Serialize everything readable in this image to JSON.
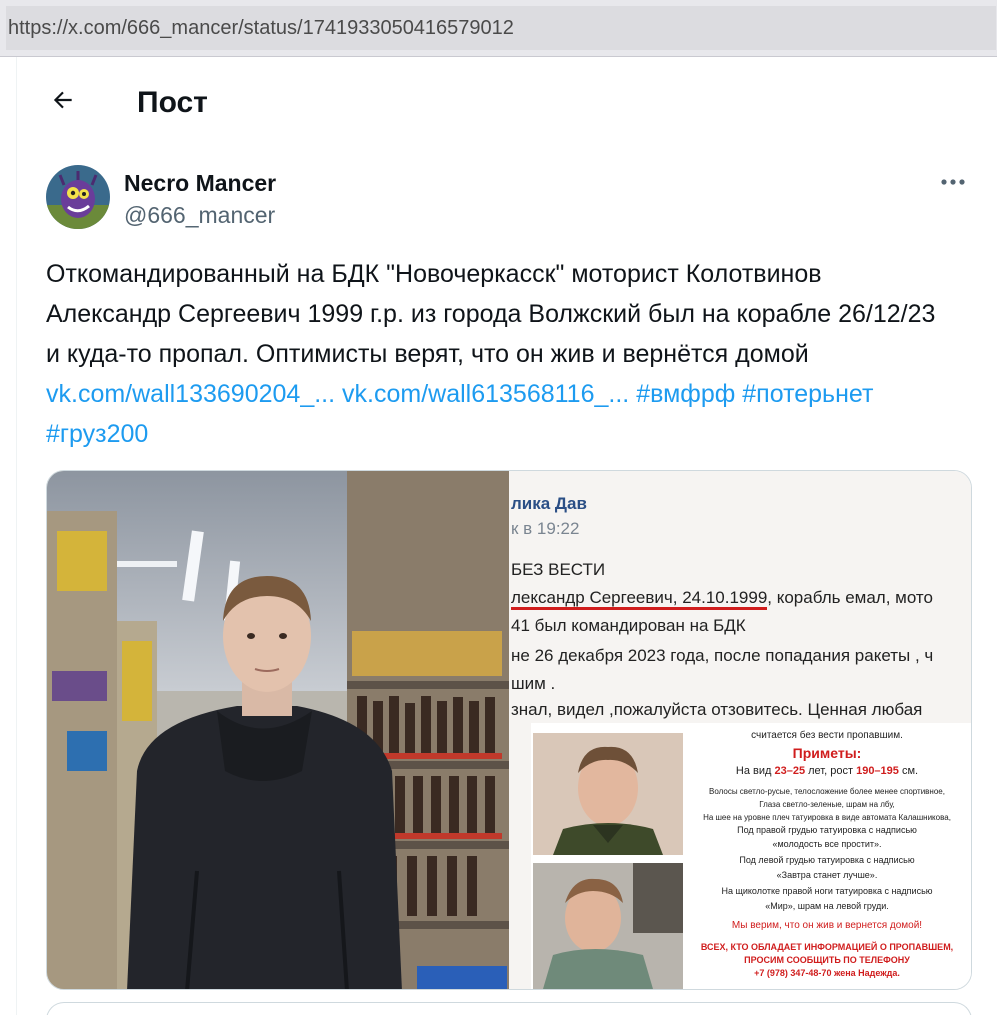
{
  "browser": {
    "url": "https://x.com/666_mancer/status/1741933050416579012"
  },
  "header": {
    "title": "Пост",
    "back_icon": "arrow-left-icon"
  },
  "author": {
    "name": "Necro Mancer",
    "handle": "@666_mancer",
    "more_icon": "more-horizontal-icon"
  },
  "tweet": {
    "text_part1": "Откомандированный на БДК \"Новочеркасск\" моторист Колотвинов Александр Сергеевич 1999 г.р. из города Волжский был на корабле 26/12/23 и куда-то пропал. Оптимисты верят, что он жив и вернётся домой ",
    "link1": "vk.com/wall133690204_...",
    "link2": "vk.com/wall613568116_...",
    "hashtag1": "#вмфрф",
    "hashtag2": "#потерьнет",
    "hashtag3": "#груз200"
  },
  "media_right": {
    "author": "лика Дав",
    "time": "к в 19:22",
    "line1": "БЕЗ ВЕСТИ",
    "line2a": "лександр Сергеевич, 24.10.1999",
    "line2b": ", корабль емал, мото",
    "line3": "41 был командирован на БДК",
    "line4": "не 26 декабря 2023 года, после попадания ракеты , ч",
    "line5": "шим .",
    "line6": "знал, видел ,пожалуйста отзовитесь. Ценная любая",
    "poster": {
      "p1": "считается без вести пропавшим.",
      "p2": "Приметы:",
      "p3a": "На вид ",
      "p3b": "23–25",
      "p3c": " лет, рост ",
      "p3d": "190–195",
      "p3e": " см.",
      "p4": "Волосы светло-русые, телосложение более менее спортивное,",
      "p5": "Глаза светло-зеленые, шрам на лбу,",
      "p6": "На шее на уровне плеч татуировка в виде автомата Калашникова,",
      "p7": "Под правой грудью татуировка с надписью",
      "p8": "«молодость все простит».",
      "p9": "Под левой грудью татуировка с надписью",
      "p10": "«Завтра станет лучше».",
      "p11": "На щиколотке правой ноги татуировка с надписью",
      "p12": "«Мир», шрам на левой груди.",
      "p13": "Мы верим, что он жив и вернется домой!",
      "p14": "ВСЕХ, КТО ОБЛАДАЕТ ИНФОРМАЦИЕЙ О ПРОПАВШЕМ,",
      "p15": "ПРОСИМ СООБЩИТЬ ПО ТЕЛЕФОНУ",
      "p16": "+7 (978) 347-48-70 жена Надежда."
    }
  },
  "colors": {
    "link": "#1d9bf0",
    "text": "#0f1419",
    "muted": "#536471",
    "border": "#cfd9de",
    "alert_red": "#d01d1d"
  }
}
